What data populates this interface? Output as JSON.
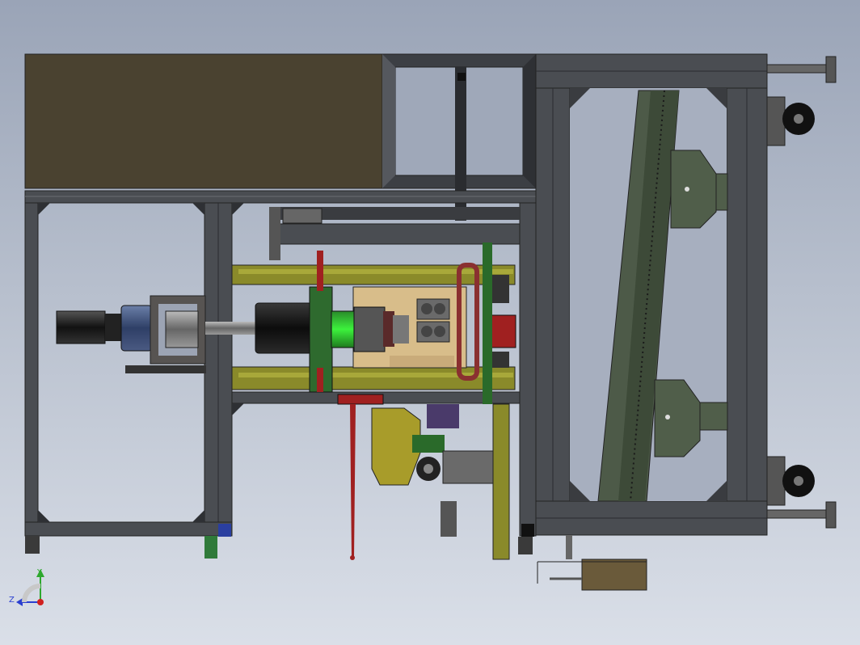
{
  "viewport": {
    "background_top": "#9aa4b7",
    "background_bottom": "#dadfe8",
    "frame_color": "#4a4d52",
    "panel_color": "#4a4230"
  },
  "triad": {
    "y_label": "Y",
    "z_label": "Z",
    "y_color": "#2ea82e",
    "z_color": "#2a3fd0",
    "x_color": "#d02020"
  }
}
